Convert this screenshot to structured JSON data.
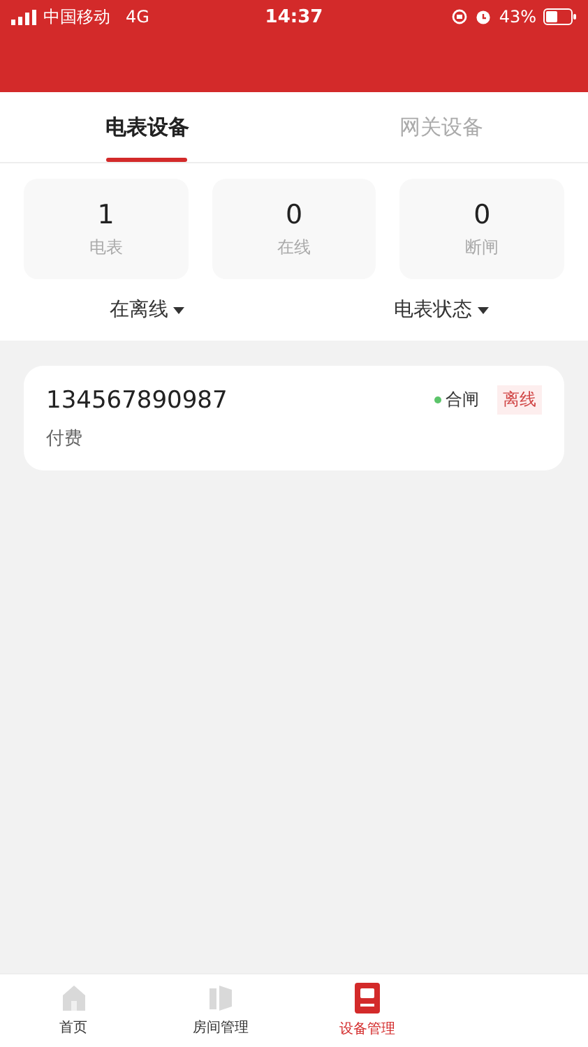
{
  "status_bar": {
    "carrier": "中国移动",
    "network": "4G",
    "time": "14:37",
    "battery": "43%"
  },
  "tabs": [
    {
      "label": "电表设备",
      "selected": true
    },
    {
      "label": "网关设备",
      "selected": false
    }
  ],
  "stats": [
    {
      "value": "1",
      "label": "电表"
    },
    {
      "value": "0",
      "label": "在线"
    },
    {
      "value": "0",
      "label": "断闸"
    }
  ],
  "filters": [
    {
      "label": "在离线"
    },
    {
      "label": "电表状态"
    }
  ],
  "meters": [
    {
      "number": "134567890987",
      "type": "付费",
      "switch_state": "合闸",
      "color": "#5cc46a",
      "online": false,
      "online_label": "离线"
    }
  ],
  "nav": [
    {
      "label": "首页",
      "kind": "home",
      "selected": false
    },
    {
      "label": "房间管理",
      "kind": "room",
      "selected": false
    },
    {
      "label": "设备管理",
      "kind": "device",
      "selected": true
    }
  ]
}
